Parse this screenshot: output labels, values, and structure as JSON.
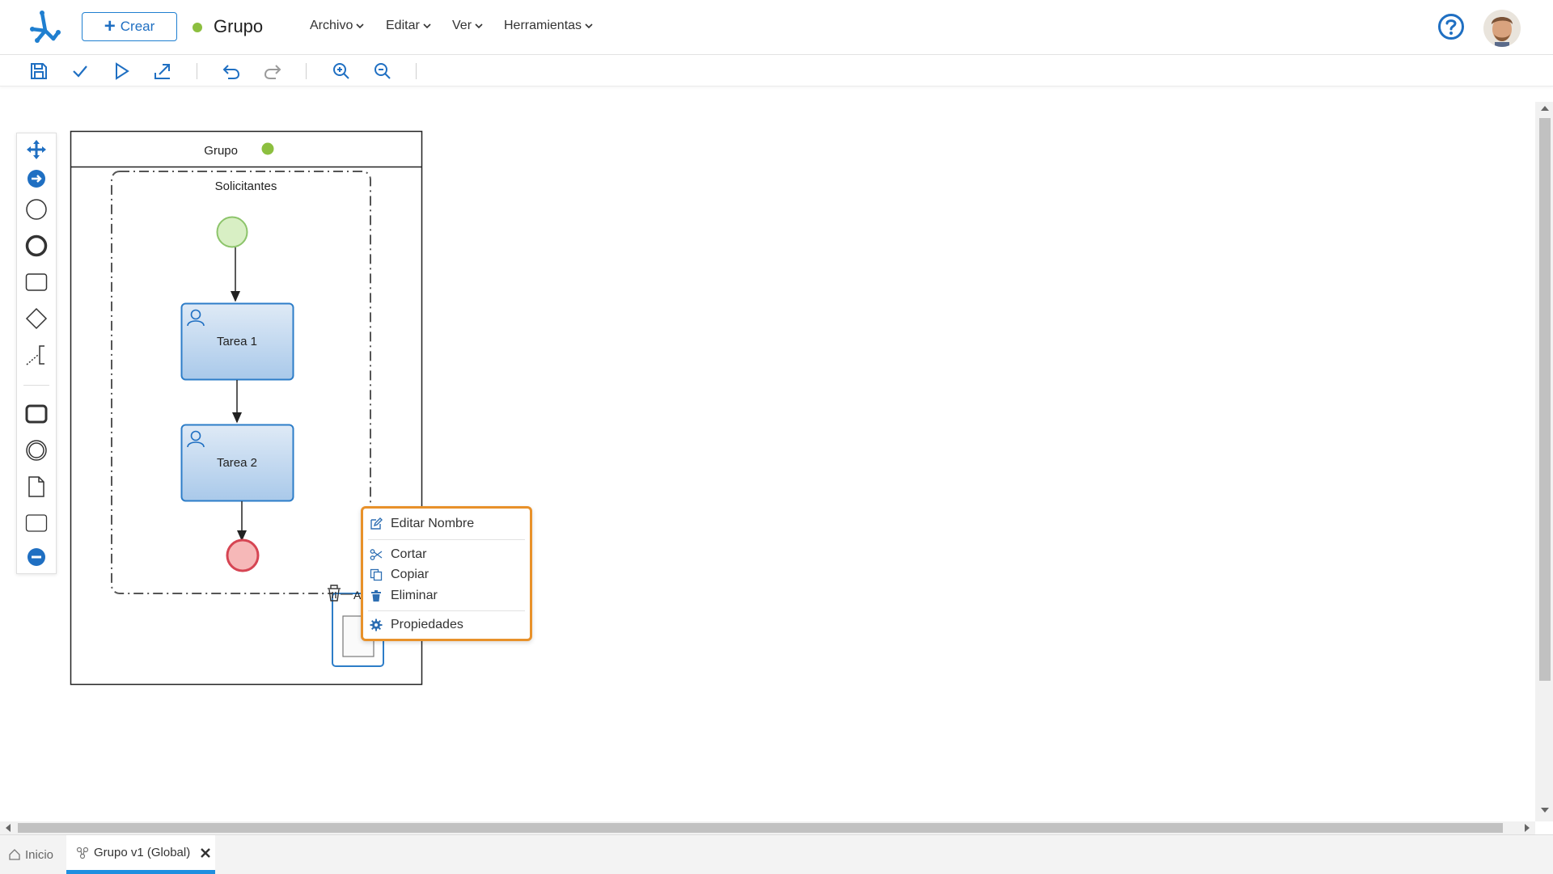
{
  "header": {
    "create_label": "Crear",
    "doc_title": "Grupo",
    "status_color": "#8cbf3f",
    "menus": [
      "Archivo",
      "Editar",
      "Ver",
      "Herramientas"
    ]
  },
  "diagram": {
    "pool_title": "Grupo",
    "group_label": "Solicitantes",
    "tasks": [
      "Tarea 1",
      "Tarea 2"
    ],
    "partial_label": "A"
  },
  "context_menu": {
    "items": [
      "Editar Nombre",
      "Cortar",
      "Copiar",
      "Eliminar",
      "Propiedades"
    ]
  },
  "tabs": {
    "home": "Inicio",
    "active": "Grupo v1 (Global)"
  },
  "colors": {
    "accent": "#1f7fd0",
    "context_border": "#e8912a",
    "task_fill": "#c5dcf1",
    "start_event": "#d8efc4",
    "end_event": "#f6b8b8"
  }
}
